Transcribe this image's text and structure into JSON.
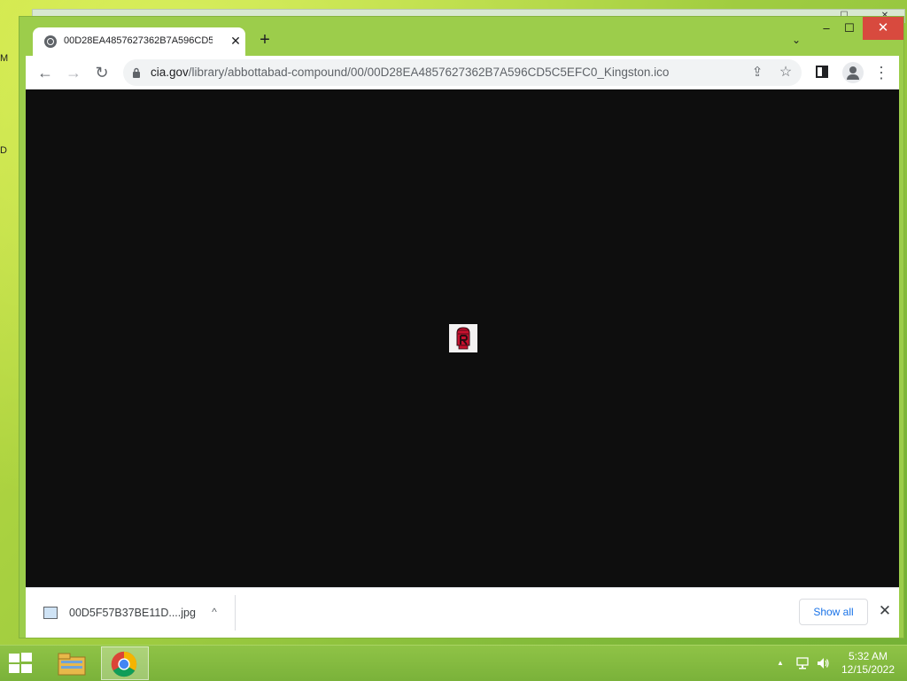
{
  "desktop": {
    "edge_labels": [
      "M",
      "D"
    ]
  },
  "browser": {
    "tab": {
      "title": "00D28EA4857627362B7A596CD5",
      "close_glyph": "✕"
    },
    "new_tab_glyph": "+",
    "tab_search_glyph": "⌄",
    "window_controls": {
      "minimize": "–",
      "maximize": "☐",
      "close": "✕"
    },
    "toolbar": {
      "back": "←",
      "forward": "→",
      "reload": "↻",
      "url_domain": "cia.gov",
      "url_path": "/library/abbottabad-compound/00/00D28EA4857627362B7A596CD5C5EFC0_Kingston.ico",
      "share": "⇪",
      "star": "☆",
      "menu": "⋮"
    },
    "content": {
      "image_alt": "Kingston icon"
    },
    "download_shelf": {
      "filename": "00D5F57B37BE11D....jpg",
      "chevron": "^",
      "show_all": "Show all",
      "close": "✕"
    }
  },
  "taskbar": {
    "tray_arrow": "▲",
    "clock_time": "5:32 AM",
    "clock_date": "12/15/2022"
  },
  "colors": {
    "desktop_green": "#9ccd4b",
    "viewport_bg": "#0e0e0e",
    "close_red": "#d84a3e",
    "link_blue": "#1a73e8"
  },
  "icons": [
    "globe-icon",
    "close-icon",
    "plus-icon",
    "chevron-down-icon",
    "back-arrow-icon",
    "forward-arrow-icon",
    "reload-icon",
    "lock-icon",
    "share-icon",
    "star-icon",
    "side-panel-icon",
    "profile-icon",
    "kebab-menu-icon",
    "image-file-icon",
    "windows-start-icon",
    "file-explorer-icon",
    "chrome-icon",
    "network-icon",
    "volume-icon"
  ]
}
